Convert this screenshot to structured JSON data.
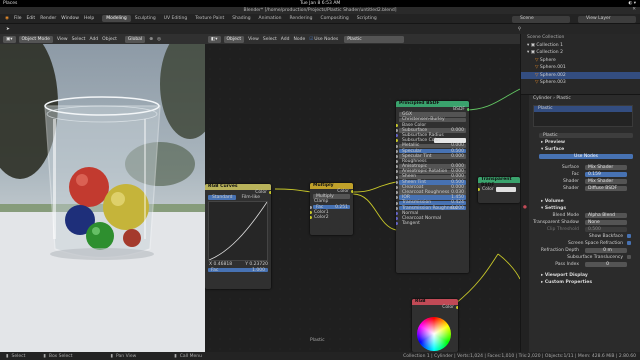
{
  "os": {
    "app": "Places",
    "clock": "Tue Jan 8  6:53 AM"
  },
  "window_title": "Blender* [/home/production/Projects/Plastic Shader/untitled2.blend]",
  "menu": [
    "File",
    "Edit",
    "Render",
    "Window",
    "Help"
  ],
  "workspaces": [
    "Modeling",
    "Sculpting",
    "UV Editing",
    "Texture Paint",
    "Shading",
    "Animation",
    "Rendering",
    "Compositing",
    "Scripting"
  ],
  "active_workspace": "Modeling",
  "scene_label": "Scene",
  "view_layer_label": "View Layer",
  "viewport_header": {
    "mode": "Object Mode",
    "items": [
      "View",
      "Select",
      "Add",
      "Object"
    ],
    "orientation": "Global"
  },
  "node_header": {
    "type": "Object",
    "items": [
      "View",
      "Select",
      "Add",
      "Node"
    ],
    "use_nodes": "Use Nodes",
    "material": "Plastic"
  },
  "nodes": {
    "principled": {
      "title": "Principled BSDF",
      "output": "BSDF",
      "distribution": "GGX",
      "subsurface_method": "Christensen-Burley",
      "rows": [
        {
          "label": "Base Color",
          "value": ""
        },
        {
          "label": "Subsurface",
          "value": "0.000"
        },
        {
          "label": "Subsurface Radius",
          "value": ""
        },
        {
          "label": "Subsurface Color",
          "value": ""
        },
        {
          "label": "Metallic",
          "value": "0.000"
        },
        {
          "label": "Specular",
          "value": "0.500"
        },
        {
          "label": "Specular Tint",
          "value": "0.000"
        },
        {
          "label": "Roughness",
          "value": ""
        },
        {
          "label": "Anisotropic",
          "value": "0.000"
        },
        {
          "label": "Anisotropic Rotation",
          "value": "0.000"
        },
        {
          "label": "Sheen",
          "value": "0.000"
        },
        {
          "label": "Sheen Tint",
          "value": "0.500"
        },
        {
          "label": "Clearcoat",
          "value": "0.000"
        },
        {
          "label": "Clearcoat Roughness",
          "value": "0.030"
        },
        {
          "label": "IOR",
          "value": "1.450"
        },
        {
          "label": "Transmission",
          "value": "0.424"
        },
        {
          "label": "Transmission Roughness",
          "value": "0.000"
        },
        {
          "label": "Normal",
          "value": ""
        },
        {
          "label": "Clearcoat Normal",
          "value": ""
        },
        {
          "label": "Tangent",
          "value": ""
        }
      ]
    },
    "rgbcurves": {
      "title": "RGB Curves",
      "output": "Color",
      "tabs": [
        "Standard",
        "Film-like"
      ],
      "readout_x": "X 0.46818",
      "readout_y": "Y 0.23720",
      "fac_label": "Fac",
      "fac_value": "1.000"
    },
    "multiply": {
      "title": "Multiply",
      "output": "Color",
      "blend": "Multiply",
      "clamp": "Clamp",
      "fac": "Fac",
      "fac_value": "0.251",
      "inputs": [
        "Color1",
        "Color2"
      ]
    },
    "transparent": {
      "title": "Transparent BSDF",
      "color": "Color"
    },
    "rgb": {
      "title": "RGB",
      "output": "Color"
    },
    "footer_label": "Plastic"
  },
  "outliner": {
    "title": "Scene Collection",
    "rows": [
      "Collection 1",
      "Collection 2",
      "Sphere",
      "Sphere.001",
      "Sphere.002",
      "Sphere.003"
    ]
  },
  "properties": {
    "object_name": "Cylinder",
    "material_name": "Plastic",
    "material_slot": "Plastic",
    "sections": {
      "preview": "Preview",
      "surface": "Surface",
      "use_nodes": "Use Nodes",
      "surface_label": "Surface",
      "surface_value": "Mix Shader",
      "fac_label": "Fac",
      "fac_value": "0.159",
      "shader1_label": "Shader",
      "shader1_value": "Mix Shader",
      "shader2_label": "Shader",
      "shader2_value": "Diffuse BSDF",
      "volume": "Volume",
      "settings": "Settings",
      "blend_mode_label": "Blend Mode",
      "blend_mode_value": "Alpha Blend",
      "shadow_mode_label": "Transparent Shadow",
      "shadow_mode_value": "None",
      "clip_label": "Clip Threshold",
      "clip_value": "0.500",
      "show_backface": "Show Backface",
      "screen_refraction": "Screen Space Refraction",
      "refraction_depth_label": "Refraction Depth",
      "refraction_depth_value": "0 m",
      "subsurface_translucency": "Subsurface Translucency",
      "pass_index_label": "Pass Index",
      "pass_index_value": "0",
      "viewport_display": "Viewport Display",
      "custom_properties": "Custom Properties"
    }
  },
  "statusbar": {
    "left": [
      "Select",
      "Box Select",
      "Pan View",
      "Call Menu"
    ],
    "right": "Collection 1 | Cylinder | Verts:1,024 | Faces:1,010 | Tris:2,020 | Objects:1/11 | Mem: 428.6 MiB | 2.80.60"
  },
  "colors": {
    "accent": "#4772b3",
    "header_principled": "#3aa36d",
    "header_curves": "#b8b25a",
    "header_multiply": "#c0a12a",
    "header_rgb": "#c14a56"
  }
}
